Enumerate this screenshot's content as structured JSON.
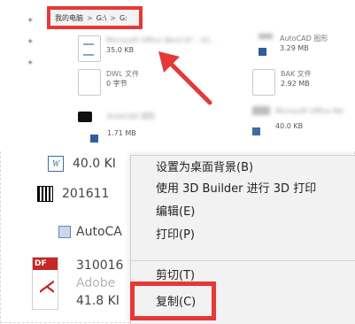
{
  "breadcrumb": {
    "items": [
      "我的电脑",
      "G:\\",
      "G:"
    ],
    "separator": ">"
  },
  "files_top": [
    {
      "name": "Microsoft Office Word 97 - 20...",
      "size": "35.0 KB",
      "icon": "word-doc-icon"
    },
    {
      "name": "AutoCAD 图形",
      "size": "3.29 MB",
      "icon": "autocad-icon"
    },
    {
      "name": "DWL 文件",
      "size": "0 字节",
      "icon": "blank-file-icon"
    },
    {
      "name": "BAK 文件",
      "size": "2.92 MB",
      "icon": "blank-file-icon"
    },
    {
      "name": "AutoCAD 图形",
      "size": "1.71 MB",
      "icon": "autocad-icon"
    },
    {
      "name": "Microsoft Office Wo",
      "size": "40.0 KB",
      "icon": "word-doc-icon"
    }
  ],
  "left_list": [
    {
      "text": "40.0 KI",
      "icon": "word-icon"
    },
    {
      "text": "201611",
      "icon": "qr-file-icon"
    },
    {
      "text": "AutoCA",
      "icon": "autocad-icon"
    },
    {
      "text": "310016",
      "icon": "pdf-icon"
    },
    {
      "text": "Adobe",
      "icon": ""
    },
    {
      "text": "41.8 KI",
      "icon": ""
    }
  ],
  "pdf_label": "DF",
  "context_menu": {
    "items": [
      "设置为桌面背景(B)",
      "使用 3D Builder 进行 3D 打印",
      "编辑(E)",
      "打印(P)",
      "剪切(T)",
      "复制(C)"
    ]
  },
  "colors": {
    "highlight_red": "#e53935",
    "menu_bg": "#f2f2f2"
  }
}
